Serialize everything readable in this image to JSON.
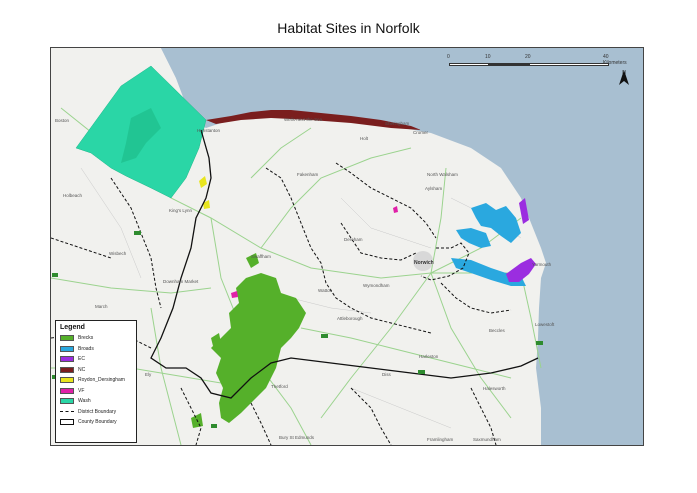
{
  "title": "Habitat Sites in Norfolk",
  "scale": {
    "ticks": [
      "0",
      "10",
      "20",
      "40 Kilometers"
    ]
  },
  "north_arrow": {
    "label": "N",
    "icon": "north-arrow-icon"
  },
  "legend": {
    "title": "Legend",
    "items": [
      {
        "label": "Brecks",
        "color": "#55b02a"
      },
      {
        "label": "Broads",
        "color": "#2aa8df"
      },
      {
        "label": "EC",
        "color": "#9b2de0"
      },
      {
        "label": "NC",
        "color": "#7a1e1e"
      },
      {
        "label": "Roydon_Dersingham",
        "color": "#e8e51e"
      },
      {
        "label": "VF",
        "color": "#e020a8"
      },
      {
        "label": "Wash",
        "color": "#2ad6a6"
      }
    ],
    "district_boundary": "District Boundary",
    "county_boundary": "County Boundary"
  },
  "places": [
    "Boston",
    "Holbeach",
    "Wisbech",
    "March",
    "Ely",
    "King's Lynn",
    "Downham Market",
    "Swaffham",
    "Thetford",
    "Fakenham",
    "Dereham",
    "Wymondham",
    "Attleborough",
    "Watton",
    "Holt",
    "Wells-next-the-Sea",
    "Sheringham",
    "Cromer",
    "North Walsham",
    "Aylsham",
    "Norwich",
    "Yarmouth",
    "Lowestoft",
    "Beccles",
    "Halesworth",
    "Harleston",
    "Diss",
    "Framlingham",
    "Saxmundham",
    "Bury St Edmunds",
    "Hunstanton"
  ],
  "colors": {
    "sea": "#a8bfd1",
    "land": "#f1f1ee",
    "road": "#8cc88a"
  }
}
